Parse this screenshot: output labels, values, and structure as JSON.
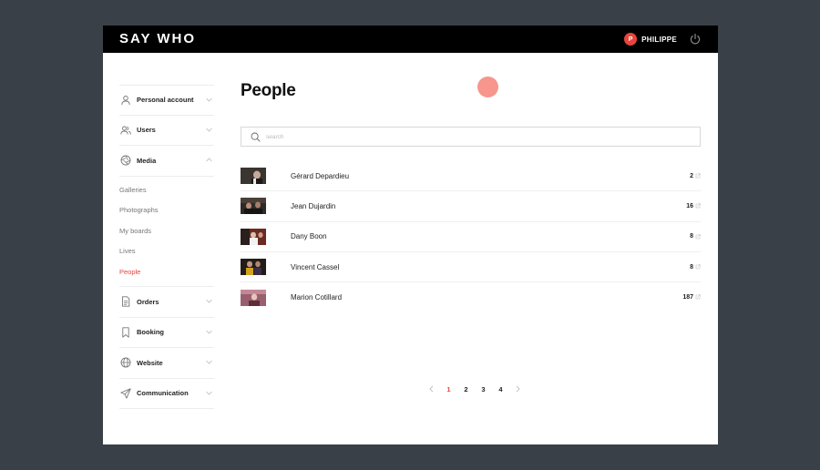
{
  "brand": {
    "logo": "SAY WHO",
    "accent": "#e8443b"
  },
  "header": {
    "user_initial": "P",
    "user_name": "PHILIPPE"
  },
  "sidebar": {
    "items_top": [
      {
        "label": "Personal account",
        "icon": "person-icon"
      },
      {
        "label": "Users",
        "icon": "users-icon"
      },
      {
        "label": "Media",
        "icon": "aperture-icon",
        "expanded": true
      }
    ],
    "media_sub": [
      {
        "label": "Galleries"
      },
      {
        "label": "Photographs"
      },
      {
        "label": "My boards"
      },
      {
        "label": "Lives"
      },
      {
        "label": "People",
        "active": true
      }
    ],
    "items_bottom": [
      {
        "label": "Orders",
        "icon": "document-icon"
      },
      {
        "label": "Booking",
        "icon": "bookmark-icon"
      },
      {
        "label": "Website",
        "icon": "globe-icon"
      },
      {
        "label": "Communication",
        "icon": "send-icon"
      }
    ]
  },
  "main": {
    "title": "People",
    "search": {
      "placeholder": "search",
      "value": ""
    },
    "people": [
      {
        "name": "Gérard Depardieu",
        "count": "2"
      },
      {
        "name": "Jean Dujardin",
        "count": "16"
      },
      {
        "name": "Dany Boon",
        "count": "8"
      },
      {
        "name": "Vincent Cassel",
        "count": "8"
      },
      {
        "name": "Marion Cotillard",
        "count": "187"
      }
    ],
    "pagination": {
      "pages": [
        "1",
        "2",
        "3",
        "4"
      ],
      "current": "1"
    }
  }
}
